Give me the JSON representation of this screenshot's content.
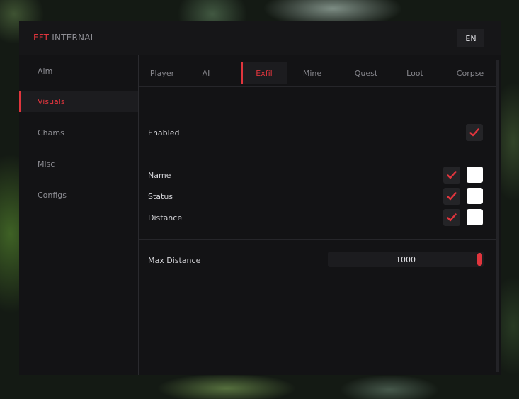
{
  "header": {
    "brand_accent": "EFT",
    "brand_rest": "INTERNAL",
    "language": "EN"
  },
  "sidebar": {
    "items": [
      {
        "label": "Aim",
        "active": false
      },
      {
        "label": "Visuals",
        "active": true
      },
      {
        "label": "Chams",
        "active": false
      },
      {
        "label": "Misc",
        "active": false
      },
      {
        "label": "Configs",
        "active": false
      }
    ]
  },
  "tabs": [
    {
      "label": "Player",
      "active": false
    },
    {
      "label": "AI",
      "active": false
    },
    {
      "label": "Exfil",
      "active": true
    },
    {
      "label": "Mine",
      "active": false
    },
    {
      "label": "Quest",
      "active": false
    },
    {
      "label": "Loot",
      "active": false
    },
    {
      "label": "Corpse",
      "active": false
    }
  ],
  "enabled": {
    "label": "Enabled",
    "checked": true
  },
  "options": [
    {
      "label": "Name",
      "checked": true,
      "color": "#ffffff"
    },
    {
      "label": "Status",
      "checked": true,
      "color": "#ffffff"
    },
    {
      "label": "Distance",
      "checked": true,
      "color": "#ffffff"
    }
  ],
  "max_distance": {
    "label": "Max Distance",
    "value": "1000",
    "fraction": 1.0
  },
  "colors": {
    "accent": "#e0353d",
    "panel": "#131315",
    "text": "#d2d2d6"
  }
}
